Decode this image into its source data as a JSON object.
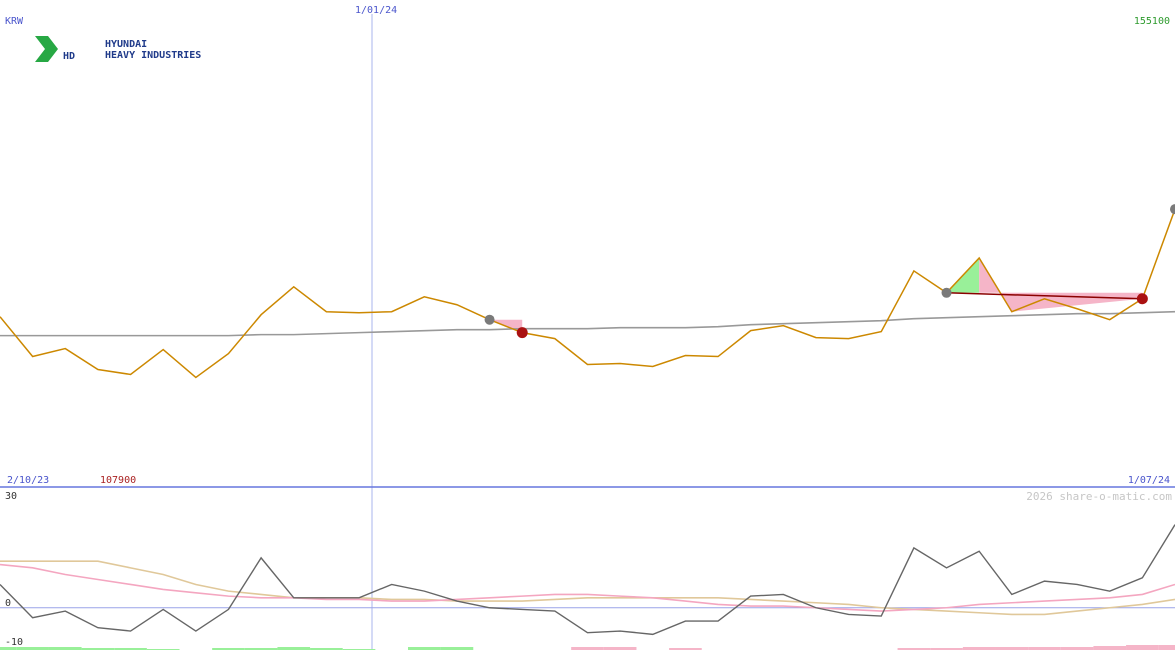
{
  "chart_data": [
    {
      "type": "line",
      "currency": "KRW",
      "date_label_top": "1/01/24",
      "start_date": "2/10/23",
      "end_date": "1/07/24",
      "y_max_label": "155100",
      "y_min_label": "107900",
      "ylim": [
        107900,
        155100
      ],
      "series": [
        {
          "values": [
            124500,
            120500,
            121300,
            119200,
            118700,
            121200,
            118400,
            120800,
            124700,
            127500,
            125000,
            124900,
            125000,
            126500,
            125700,
            124200,
            122900,
            122300,
            119700,
            119800,
            119500,
            120600,
            120500,
            123100,
            123600,
            122400,
            122300,
            123000,
            129100,
            126900,
            130400,
            125000,
            126300,
            125300,
            124200,
            126300,
            135300
          ]
        },
        {
          "values": [
            122600,
            122600,
            122600,
            122600,
            122600,
            122600,
            122600,
            122600,
            122700,
            122700,
            122800,
            122900,
            123000,
            123100,
            123200,
            123200,
            123300,
            123300,
            123300,
            123400,
            123400,
            123400,
            123500,
            123700,
            123800,
            123900,
            124000,
            124100,
            124300,
            124400,
            124500,
            124600,
            124700,
            124800,
            124800,
            124900,
            125000
          ]
        }
      ],
      "peaks": [
        15,
        30,
        36
      ],
      "troughs": [
        16,
        35
      ]
    },
    {
      "type": "line",
      "y_labels": [
        "30",
        "0",
        "-10"
      ],
      "ylim": [
        -10,
        30
      ],
      "series": [
        {
          "values": [
            7,
            -3,
            -1,
            -6,
            -7,
            -0.5,
            -7,
            -0.5,
            15,
            3,
            3,
            3,
            7,
            5,
            2,
            0,
            -0.5,
            -1,
            -7.5,
            -7,
            -8,
            -4,
            -4,
            3.5,
            4,
            0,
            -2,
            -2.5,
            18,
            12,
            17,
            4,
            8,
            7,
            5,
            9,
            25
          ]
        },
        {
          "values": [
            13,
            12,
            10,
            8.5,
            7,
            5.5,
            4.5,
            3.5,
            3,
            3,
            2.5,
            2.5,
            2,
            2,
            2.5,
            3,
            3.5,
            4,
            4,
            3.5,
            3,
            2,
            1,
            0.5,
            0.5,
            0,
            -0.5,
            -1,
            -0.5,
            0,
            1,
            1.5,
            2,
            2.5,
            3,
            4,
            7
          ]
        },
        {
          "values": [
            14,
            14,
            14,
            14,
            12,
            10,
            7,
            5,
            4,
            3,
            3,
            3,
            2.5,
            2.5,
            2,
            2,
            2,
            2.5,
            3,
            3,
            3,
            3,
            3,
            2.5,
            2,
            1.5,
            1,
            0,
            -0.5,
            -1,
            -1.5,
            -2,
            -2,
            -1,
            0,
            1,
            2.5
          ]
        }
      ],
      "histogram": [
        3,
        3,
        3,
        2,
        2,
        1,
        0,
        2,
        2,
        3,
        2,
        1,
        0,
        3,
        3,
        0,
        0,
        0,
        -3,
        -3,
        0,
        -2,
        0,
        0,
        0,
        0,
        0,
        0,
        -2,
        -2,
        -3,
        -3,
        -3,
        -3,
        -4,
        -5,
        -5
      ]
    }
  ],
  "watermark": "2026 share-o-matic.com",
  "logo": {
    "name": "HD",
    "line1": "HYUNDAI",
    "line2": "HEAVY INDUSTRIES"
  },
  "colors": {
    "price": "#cc8800",
    "average": "#999999",
    "oscillator": "#666666",
    "signal_pink": "#f4a6c0",
    "signal_tan": "#e0c89a",
    "up_fill": "#99f099",
    "down_fill": "#f5b5c8",
    "axis_blue": "#6677dd",
    "trendline": "#8b0000",
    "logo_green": "#27a844",
    "logo_blue": "#1f3a8a"
  }
}
